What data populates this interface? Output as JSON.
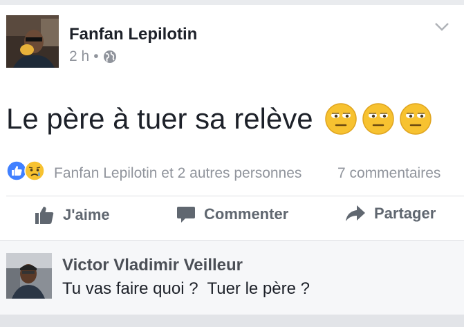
{
  "post": {
    "author": "Fanfan Lepilotin",
    "time": "2 h",
    "separator": "•",
    "audience_icon": "globe-icon",
    "text": "Le père à tuer sa relève",
    "emoji_icon": "neutral-face-emoji",
    "emoji_count": 3
  },
  "reactions": {
    "icons": [
      "like-icon",
      "sad-icon"
    ],
    "summary": "Fanfan Lepilotin et 2 autres personnes",
    "comments_count": "7 commentaires"
  },
  "actions": {
    "like_label": "J'aime",
    "comment_label": "Commenter",
    "share_label": "Partager"
  },
  "comment": {
    "author": "Victor Vladimir Veilleur",
    "text": "Tu vas faire quoi ?  Tuer le père ?"
  },
  "colors": {
    "like_blue": "#4080ff",
    "sad_yellow": "#f7c230",
    "icon_gray": "#606770",
    "meta_gray": "#90949c"
  }
}
